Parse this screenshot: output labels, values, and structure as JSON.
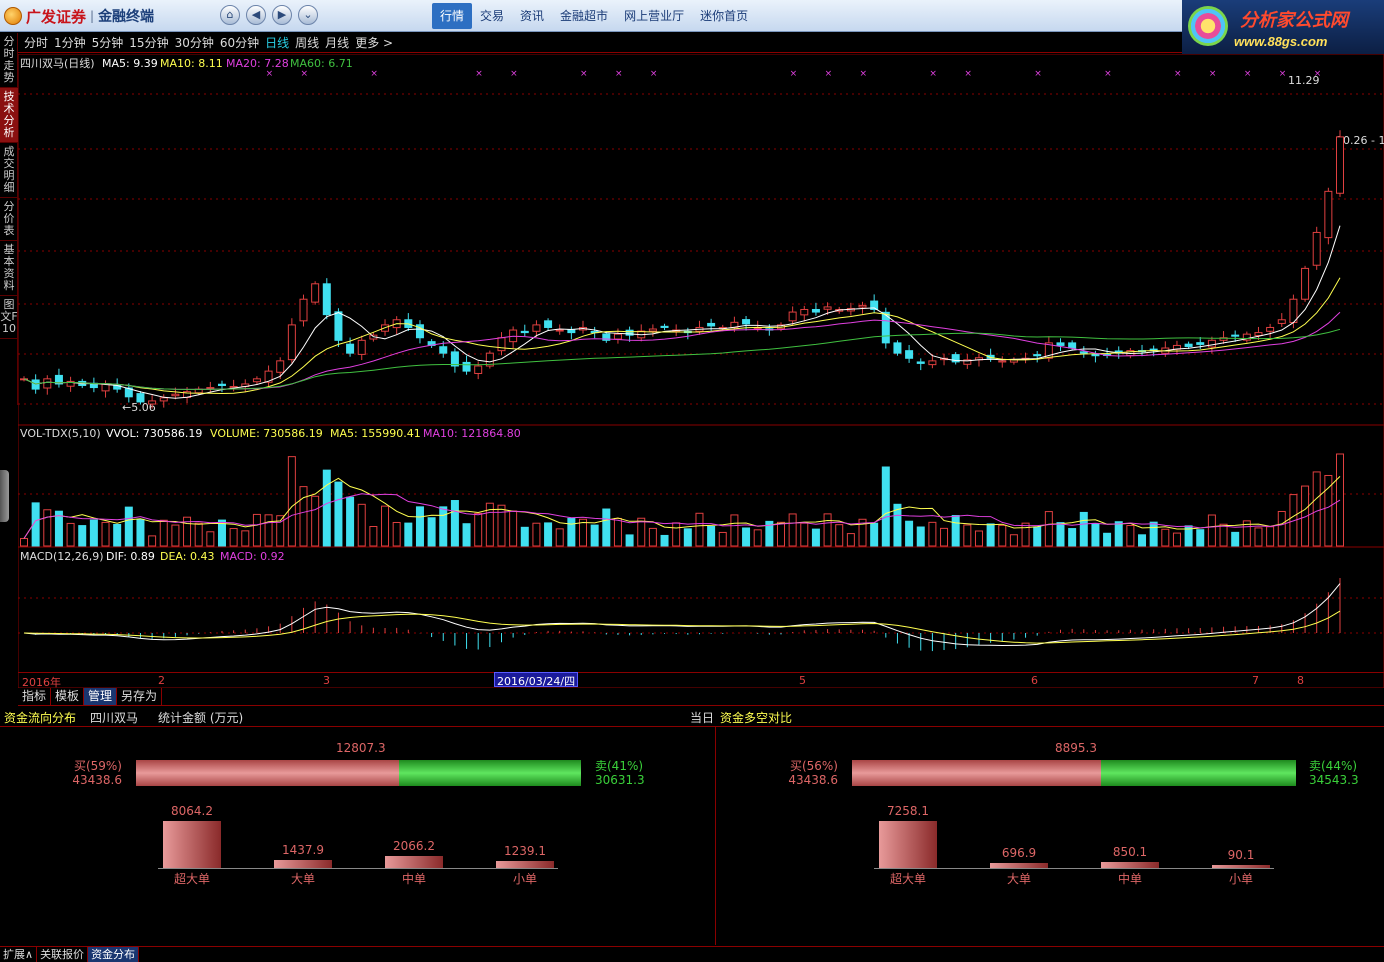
{
  "app": {
    "brand": "广发证券",
    "separator": "|",
    "subtitle": "金融终端"
  },
  "nav": {
    "icons": [
      "home-icon",
      "back-icon",
      "forward-icon",
      "collapse-icon"
    ],
    "items": [
      "行情",
      "交易",
      "资讯",
      "金融超市",
      "网上营业厅",
      "迷你首页"
    ],
    "active": 0
  },
  "promo": {
    "title": "分析家公式网",
    "url": "www.88gs.com"
  },
  "left_tabs": [
    "分时走势",
    "技术分析",
    "成交明细",
    "分价表",
    "基本资料",
    "图文F10"
  ],
  "left_tab_active": 1,
  "periods": [
    "分时",
    "1分钟",
    "5分钟",
    "15分钟",
    "30分钟",
    "60分钟",
    "日线",
    "周线",
    "月线",
    "更多 >"
  ],
  "period_active": 6,
  "main_legend": {
    "name": "四川双马(日线)",
    "ma5": "MA5: 9.39",
    "ma10": "MA10: 8.11",
    "ma20": "MA20: 7.28",
    "ma60": "MA60: 6.71"
  },
  "price_labels": {
    "high": "11.29",
    "last": "10.26 - 1",
    "low": "5.06"
  },
  "vol_legend": {
    "name": "VOL-TDX(5,10)",
    "vvol": "VVOL: 730586.19",
    "volume": "VOLUME: 730586.19",
    "ma5": "MA5: 155990.41",
    "ma10": "MA10: 121864.80"
  },
  "macd_legend": {
    "name": "MACD(12,26,9)",
    "dif": "DIF: 0.89",
    "dea": "DEA: 0.43",
    "macd": "MACD: 0.92"
  },
  "time_axis": [
    "2016年",
    "2",
    "3",
    "5",
    "6",
    "7",
    "8"
  ],
  "cursor_date": "2016/03/24/四",
  "sub_tabs": [
    "指标",
    "模板",
    "管理",
    "另存为"
  ],
  "sub_tab_active": 2,
  "panel_left": {
    "title": "资金流向分布",
    "stock": "四川双马",
    "unit": "统计金额 (万元)",
    "period": "当日",
    "total": "12807.3",
    "buy_label": "买(59%)",
    "buy_value": "43438.6",
    "sell_label": "卖(41%)",
    "sell_value": "30631.3",
    "buy_fraction": 0.59,
    "bars": [
      {
        "label": "超大单",
        "value": "8064.2",
        "amount": 8064.2
      },
      {
        "label": "大单",
        "value": "1437.9",
        "amount": 1437.9
      },
      {
        "label": "中单",
        "value": "2066.2",
        "amount": 2066.2
      },
      {
        "label": "小单",
        "value": "1239.1",
        "amount": 1239.1
      }
    ]
  },
  "panel_right": {
    "title": "资金多空对比",
    "total": "8895.3",
    "buy_label": "买(56%)",
    "buy_value": "43438.6",
    "sell_label": "卖(44%)",
    "sell_value": "34543.3",
    "buy_fraction": 0.56,
    "bars": [
      {
        "label": "超大单",
        "value": "7258.1",
        "amount": 7258.1
      },
      {
        "label": "大单",
        "value": "696.9",
        "amount": 696.9
      },
      {
        "label": "中单",
        "value": "850.1",
        "amount": 850.1
      },
      {
        "label": "小单",
        "value": "90.1",
        "amount": 90.1
      }
    ]
  },
  "bottom_tabs": [
    "扩展∧",
    "关联报价",
    "资金分布"
  ],
  "bottom_tab_active": 2,
  "colors": {
    "up": "#e04040",
    "down": "#40e0f0",
    "ma5": "#ffffff",
    "ma10": "#ffff50",
    "ma20": "#e040e0",
    "ma60": "#40c040",
    "grid": "#8a0000"
  },
  "chart_data": {
    "type": "candlestick",
    "stock": "四川双马",
    "period": "日线",
    "ylim": [
      5.06,
      11.29
    ],
    "closes": [
      5.55,
      5.35,
      5.55,
      5.45,
      5.5,
      5.42,
      5.38,
      5.45,
      5.35,
      5.2,
      5.1,
      5.12,
      5.18,
      5.25,
      5.3,
      5.35,
      5.38,
      5.42,
      5.4,
      5.45,
      5.55,
      5.7,
      5.9,
      6.6,
      7.1,
      7.4,
      6.8,
      6.3,
      6.05,
      6.3,
      6.4,
      6.6,
      6.7,
      6.55,
      6.35,
      6.2,
      6.05,
      5.8,
      5.7,
      5.8,
      6.05,
      6.35,
      6.5,
      6.45,
      6.6,
      6.55,
      6.5,
      6.45,
      6.55,
      6.45,
      6.3,
      6.42,
      6.4,
      6.48,
      6.52,
      6.55,
      6.5,
      6.45,
      6.55,
      6.58,
      6.55,
      6.65,
      6.62,
      6.55,
      6.5,
      6.6,
      6.85,
      6.9,
      6.85,
      6.95,
      6.9,
      6.92,
      6.98,
      6.9,
      6.25,
      6.05,
      5.95,
      5.85,
      5.9,
      5.95,
      5.88,
      5.92,
      5.96,
      5.95,
      5.9,
      5.92,
      5.95,
      6.0,
      6.25,
      6.2,
      6.15,
      6.05,
      6.0,
      6.02,
      6.05,
      6.1,
      6.08,
      6.12,
      6.15,
      6.2,
      6.18,
      6.22,
      6.3,
      6.35,
      6.38,
      6.42,
      6.45,
      6.55,
      6.7,
      7.1,
      7.7,
      8.4,
      9.2,
      10.26
    ]
  }
}
